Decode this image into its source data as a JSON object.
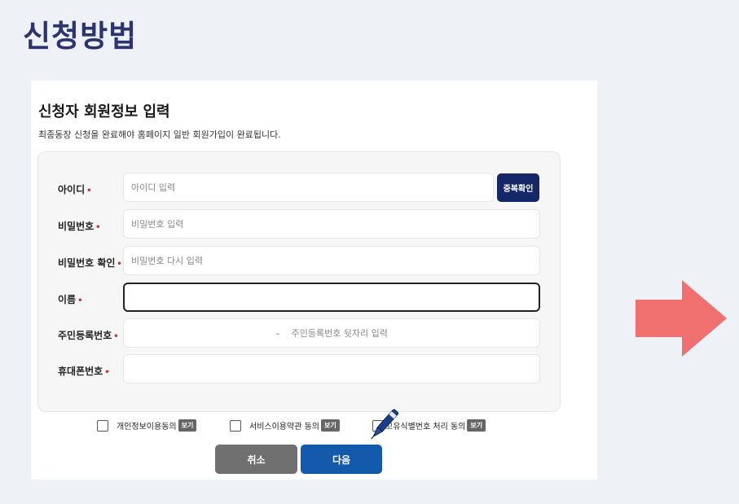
{
  "page": {
    "heading": "신청방법"
  },
  "form": {
    "title": "신청자 회원정보 입력",
    "description": "최종동장 신청을 완료해야 홈페이지 일반 회원가입이 완료됩니다.",
    "required_mark": "•",
    "fields": [
      {
        "label": "아이디",
        "placeholder": "아이디 입력",
        "value": ""
      },
      {
        "label": "비밀번호",
        "placeholder": "비밀번호 입력",
        "value": ""
      },
      {
        "label": "비밀번호 확인",
        "placeholder": "비밀번호 다시 입력",
        "value": ""
      },
      {
        "label": "이름",
        "placeholder": "",
        "value": ""
      },
      {
        "label": "주민등록번호",
        "separator": "–",
        "placeholder": "주민등록번호 뒷자리 입력",
        "value": ""
      },
      {
        "label": "휴대폰번호",
        "placeholder": "",
        "value": ""
      }
    ],
    "duplicate_check_label": "중복확인"
  },
  "agreements": [
    {
      "label": "개인정보이용동의",
      "checked": false,
      "view_label": "보기"
    },
    {
      "label": "서비스이용약관 동의",
      "checked": false,
      "view_label": "보기"
    },
    {
      "label": "고유식별번호 처리 동의",
      "checked": false,
      "view_label": "보기"
    }
  ],
  "buttons": {
    "cancel_label": "취소",
    "next_label": "다음"
  },
  "icons": {
    "pen": "pen-icon",
    "arrow": "arrow-right-icon"
  },
  "colors": {
    "heading": "#2b3471",
    "primary": "#135aad",
    "dark_navy": "#142868",
    "cancel": "#707070",
    "required": "#d03030",
    "arrow": "#f07070"
  }
}
